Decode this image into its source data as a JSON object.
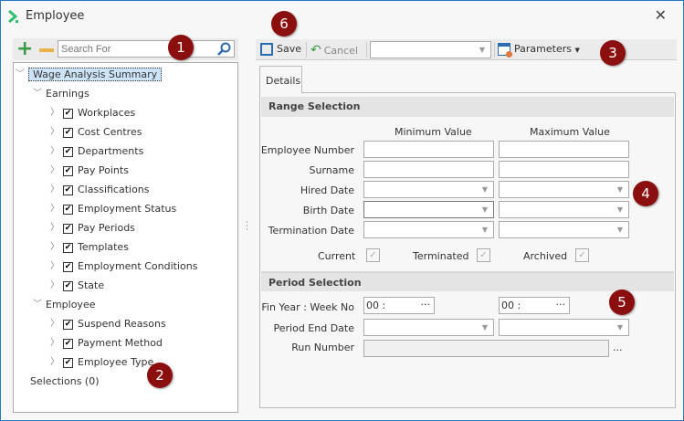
{
  "window": {
    "title": "Employee",
    "close": "✕"
  },
  "left": {
    "search_placeholder": "Search For",
    "tree": {
      "root": "Wage Analysis Summary",
      "earnings": "Earnings",
      "earnings_items": [
        "Workplaces",
        "Cost Centres",
        "Departments",
        "Pay Points",
        "Classifications",
        "Employment Status",
        "Pay Periods",
        "Templates",
        "Employment Conditions",
        "State"
      ],
      "employee": "Employee",
      "employee_items": [
        "Suspend Reasons",
        "Payment Method",
        "Employee Type"
      ],
      "selections": "Selections (0)"
    }
  },
  "toolbar": {
    "save": "Save",
    "cancel": "Cancel",
    "parameters": "Parameters"
  },
  "tabs": [
    "Details"
  ],
  "range": {
    "title": "Range Selection",
    "min_header": "Minimum Value",
    "max_header": "Maximum Value",
    "rows": [
      "Employee Number",
      "Surname",
      "Hired Date",
      "Birth Date",
      "Termination Date"
    ],
    "checks": [
      {
        "label": "Current",
        "checked": true
      },
      {
        "label": "Terminated",
        "checked": true
      },
      {
        "label": "Archived",
        "checked": true
      }
    ]
  },
  "period": {
    "title": "Period Selection",
    "fin_label": "Fin Year : Week No",
    "fin_min": "00  :",
    "fin_max": "00  :",
    "ellipsis": "···",
    "end_label": "Period End Date",
    "run_label": "Run Number",
    "run_more": "..."
  },
  "badges": [
    "1",
    "2",
    "3",
    "4",
    "5",
    "6"
  ]
}
